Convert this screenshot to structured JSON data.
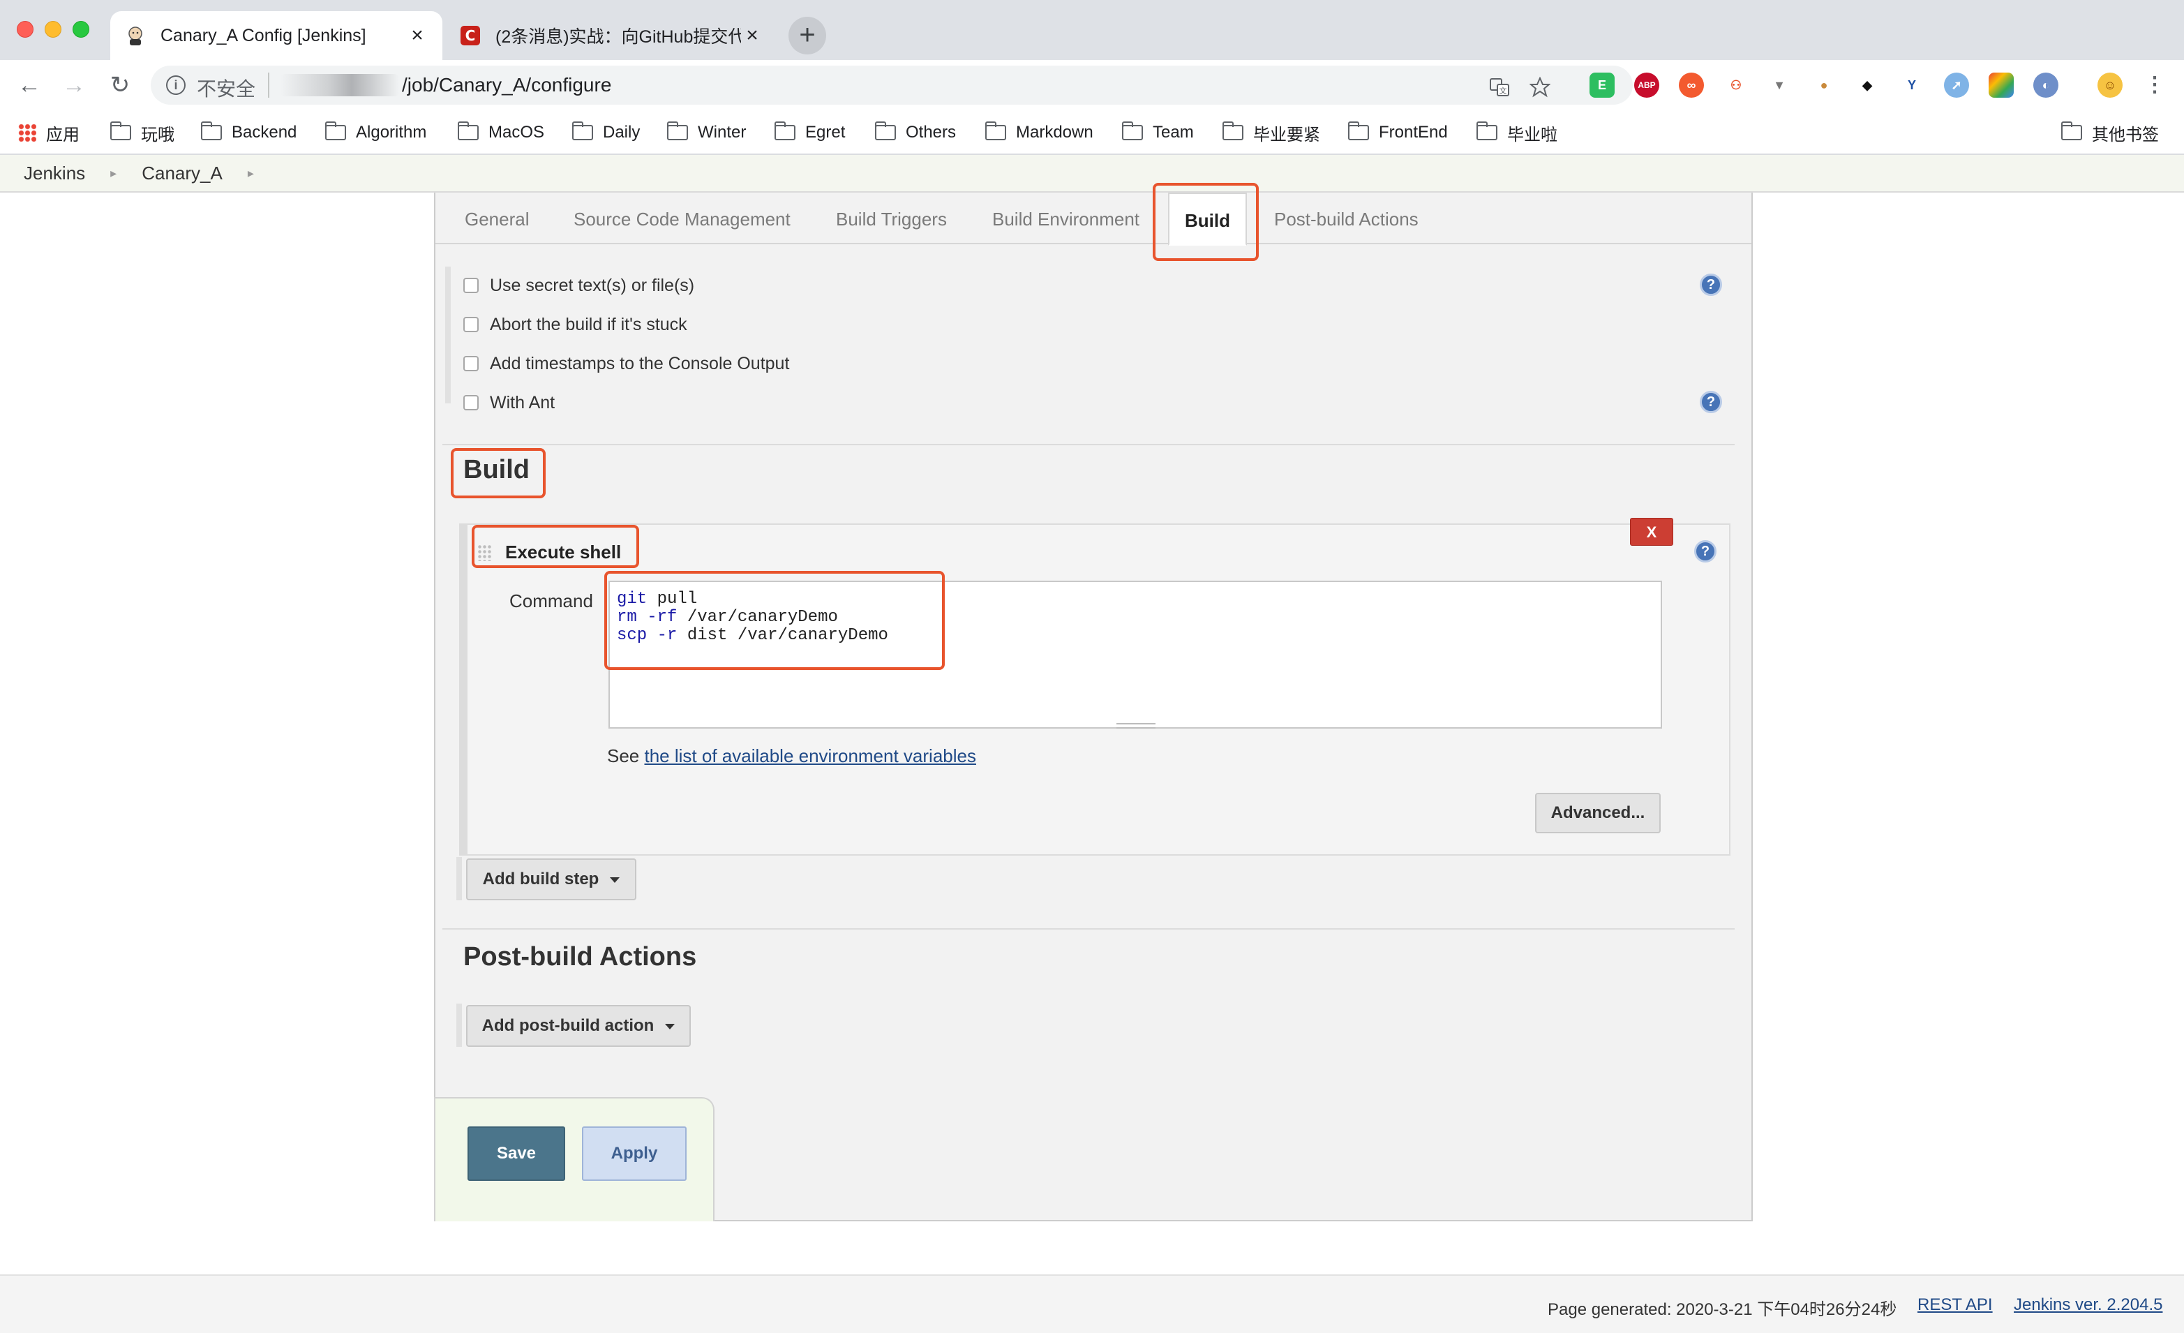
{
  "browser": {
    "tabs": [
      {
        "title": "Canary_A Config [Jenkins]",
        "close": "×"
      },
      {
        "title": "(2条消息)实战：向GitHub提交代",
        "close": "×"
      }
    ],
    "new_tab": "+",
    "nav": {
      "back": "←",
      "forward": "→",
      "reload": "↻"
    },
    "omnibox": {
      "security_label": "不安全",
      "url": "/job/Canary_A/configure"
    },
    "bookmarks": [
      {
        "label": "应用",
        "type": "apps"
      },
      {
        "label": "玩哦",
        "type": "folder"
      },
      {
        "label": "Backend",
        "type": "folder"
      },
      {
        "label": "Algorithm",
        "type": "folder"
      },
      {
        "label": "MacOS",
        "type": "folder"
      },
      {
        "label": "Daily",
        "type": "folder"
      },
      {
        "label": "Winter",
        "type": "folder"
      },
      {
        "label": "Egret",
        "type": "folder"
      },
      {
        "label": "Others",
        "type": "folder"
      },
      {
        "label": "Markdown",
        "type": "folder"
      },
      {
        "label": "Team",
        "type": "folder"
      },
      {
        "label": "毕业要紧",
        "type": "folder"
      },
      {
        "label": "FrontEnd",
        "type": "folder"
      },
      {
        "label": "毕业啦",
        "type": "folder"
      }
    ],
    "other_bookmarks": "其他书签",
    "extension_icons": [
      "evernote-icon",
      "adblock-plus-icon",
      "extension-icon",
      "network-icon",
      "vue-devtools-icon",
      "cookie-icon",
      "git-icon",
      "y-icon",
      "compass-icon",
      "chrome-extension-icon",
      "proxy-icon",
      "avatar-icon"
    ]
  },
  "breadcrumb": [
    "Jenkins",
    "Canary_A"
  ],
  "config_tabs": [
    "General",
    "Source Code Management",
    "Build Triggers",
    "Build Environment",
    "Build",
    "Post-build Actions"
  ],
  "active_tab": "Build",
  "build_environment": {
    "options": [
      {
        "label": "Use secret text(s) or file(s)",
        "checked": false
      },
      {
        "label": "Abort the build if it's stuck",
        "checked": false
      },
      {
        "label": "Add timestamps to the Console Output",
        "checked": false
      },
      {
        "label": "With Ant",
        "checked": false
      }
    ]
  },
  "build": {
    "heading": "Build",
    "step": {
      "title": "Execute shell",
      "delete_label": "X",
      "command_label": "Command",
      "command_lines": [
        "git pull",
        "rm -rf /var/canaryDemo",
        "scp -r dist /var/canaryDemo"
      ],
      "see_prefix": "See ",
      "see_link": "the list of available environment variables",
      "advanced_button": "Advanced..."
    },
    "add_step_button": "Add build step"
  },
  "post_build": {
    "heading": "Post-build Actions",
    "add_action_button": "Add post-build action"
  },
  "buttons": {
    "save": "Save",
    "apply": "Apply"
  },
  "footer": {
    "generated": "Page generated: 2020-3-21 下午04时26分24秒",
    "rest_api": "REST API",
    "version": "Jenkins ver. 2.204.5"
  },
  "colors": {
    "highlight": "#e8542d",
    "save_button": "#4b758b",
    "delete_button": "#cc3e33",
    "link": "#204a87"
  }
}
